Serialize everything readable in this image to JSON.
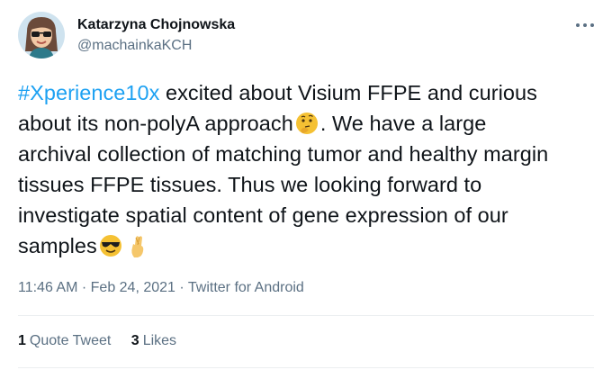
{
  "author": {
    "name": "Katarzyna Chojnowska",
    "handle": "@machainkaKCH",
    "avatar_icon": "avatar-sunglasses-memoji"
  },
  "menu_icon": "more-horizontal-icon",
  "tweet": {
    "hashtag": "#Xperience10x",
    "lines": [
      " excited about Visium FFPE and curious",
      "about its non-polyA approach",
      ". We have a large",
      "archival collection of matching tumor and healthy margin",
      "tissues FFPE tissues. Thus we looking forward to",
      "investigate spatial content of gene expression of our",
      "samples"
    ],
    "emojis": [
      "thinking-face-emoji",
      "smiling-face-with-sunglasses-emoji",
      "crossed-fingers-emoji"
    ]
  },
  "meta": {
    "time": "11:46 AM",
    "sep1": " · ",
    "date": "Feb 24, 2021",
    "sep2": " · ",
    "source": "Twitter for Android"
  },
  "stats": {
    "quote_count": "1",
    "quote_label": "Quote Tweet",
    "likes_count": "3",
    "likes_label": "Likes"
  },
  "colors": {
    "link": "#1da1f2",
    "secondary_text": "#5b7083",
    "primary_text": "#0f1419",
    "divider": "#ebeef0"
  }
}
